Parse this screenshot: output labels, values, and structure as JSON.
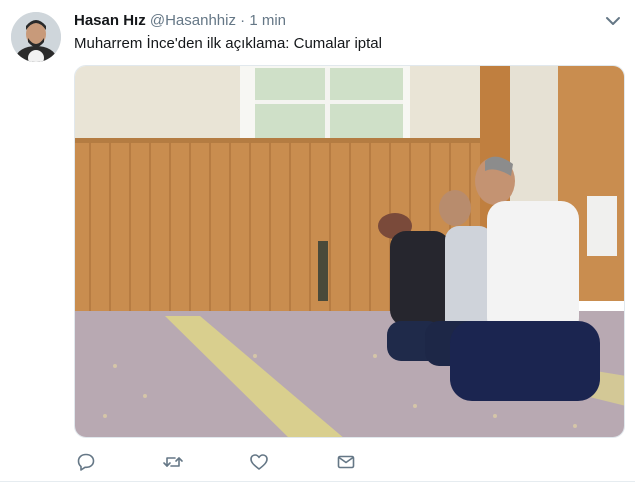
{
  "tweet": {
    "author_name": "Hasan Hız",
    "handle": "@Hasanhhiz",
    "separator": "·",
    "time": "1 min",
    "text": "Muharrem İnce'den ilk açıklama: Cumalar iptal"
  },
  "icons": {
    "caret": "chevron-down-icon",
    "reply": "reply-icon",
    "retweet": "retweet-icon",
    "like": "heart-icon",
    "message": "envelope-icon"
  },
  "colors": {
    "name": "#14171a",
    "secondary": "#657786"
  }
}
